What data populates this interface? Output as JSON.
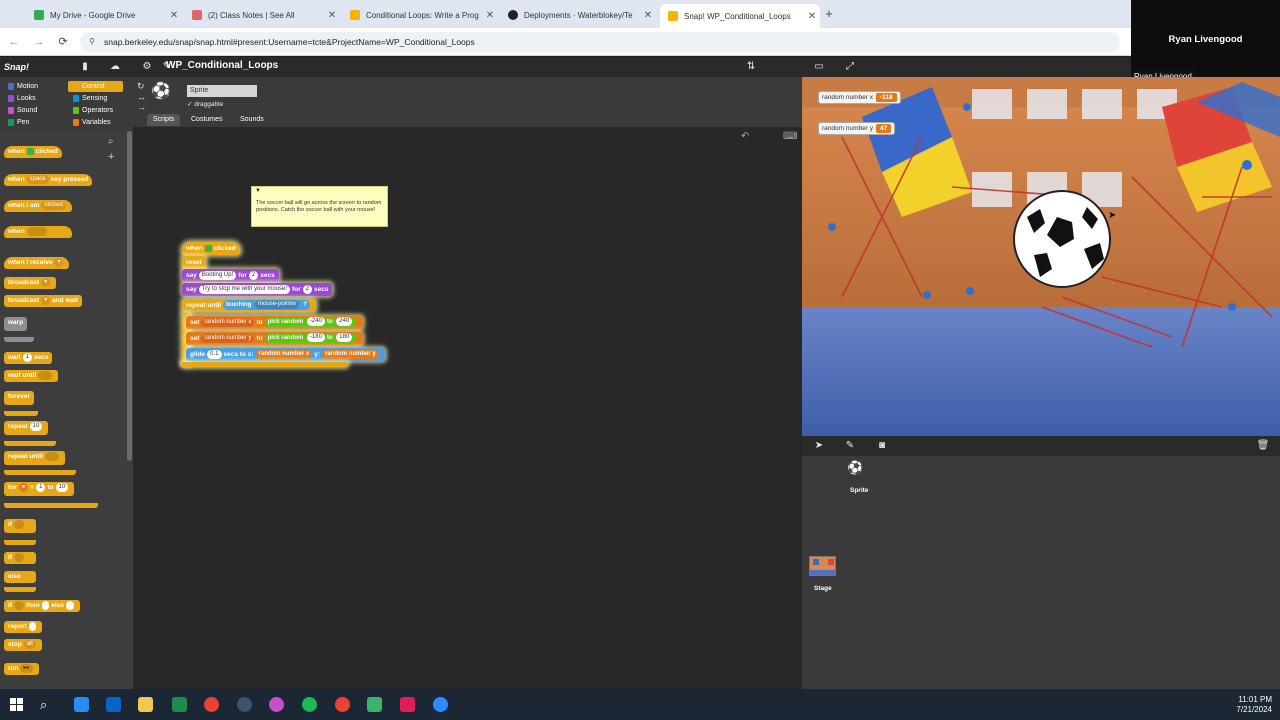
{
  "browser": {
    "tabs": [
      {
        "label": "My Drive - Google Drive",
        "color": "#34a853"
      },
      {
        "label": "(2) Class Notes | See All",
        "color": "#e06666"
      },
      {
        "label": "Conditional Loops: Write a Prog",
        "color": "#f4b400"
      },
      {
        "label": "Deployments · Waterblokey/Te",
        "color": "#222222"
      },
      {
        "label": "Snap! WP_Conditional_Loops",
        "color": "#f4b400"
      }
    ],
    "url": "snap.berkeley.edu/snap/snap.html#present:Username=tcte&ProjectName=WP_Conditional_Loops"
  },
  "zoom": {
    "participant_name": "Ryan Livengood",
    "name_tag": "Ryan Livengood"
  },
  "snap": {
    "project_title": "WP_Conditional_Loops",
    "categories": [
      "Motion",
      "Looks",
      "Sound",
      "Pen",
      "Control",
      "Sensing",
      "Operators",
      "Variables"
    ],
    "sprite_name": "Sprite",
    "draggable_label": "draggable",
    "tabs": [
      "Scripts",
      "Costumes",
      "Sounds"
    ],
    "palette": {
      "when_flag": {
        "a": "when",
        "b": "clicked"
      },
      "when_key": {
        "a": "when",
        "slot": "space",
        "b": "key pressed"
      },
      "when_i_am": {
        "a": "when I am",
        "slot": "clicked"
      },
      "when_cond": "when",
      "when_receive": {
        "a": "when I receive"
      },
      "broadcast": "broadcast",
      "broadcast_wait": {
        "a": "broadcast",
        "b": "and wait"
      },
      "warp": "warp",
      "wait": {
        "a": "wait",
        "slot": "1",
        "b": "secs"
      },
      "wait_until": "wait until",
      "forever": "forever",
      "repeat": {
        "a": "repeat",
        "slot": "10"
      },
      "repeat_until": "repeat until",
      "for": {
        "a": "for",
        "b": "=",
        "slot1": "1",
        "c": "to",
        "slot2": "10"
      },
      "if": "if",
      "if_else_a": "if",
      "if_else_b": "else",
      "if_then_else": {
        "a": "if",
        "b": "then",
        "c": "else"
      },
      "report": "report",
      "stop": {
        "a": "stop",
        "slot": "all"
      },
      "run": "run"
    },
    "comment": "The soccer ball will go across the screen to random positions. Catch the soccer ball with your mouse!",
    "script": {
      "hat": {
        "a": "when",
        "b": "clicked"
      },
      "reset": "reset",
      "say1": {
        "a": "say",
        "slot": "Booting Up!",
        "b": "for",
        "secs": "2",
        "c": "secs"
      },
      "say2": {
        "a": "say",
        "slot": "Try to stop me with your mouse!",
        "b": "for",
        "secs": "2",
        "c": "secs"
      },
      "repeat_until": {
        "a": "repeat until",
        "touching": "touching",
        "target": "mouse-pointer",
        "q": "?"
      },
      "set_x": {
        "a": "set",
        "var": "random number x",
        "b": "to",
        "c": "pick random",
        "min": "-240",
        "d": "to",
        "max": "240"
      },
      "set_y": {
        "a": "set",
        "var": "random number y",
        "b": "to",
        "c": "pick random",
        "min": "-180",
        "d": "to",
        "max": "180"
      },
      "glide": {
        "a": "glide",
        "secs": "0.1",
        "b": "secs to x:",
        "x": "random number x",
        "c": "y:",
        "y": "random number y"
      }
    },
    "watchers": [
      {
        "label": "random number x",
        "value": "-118"
      },
      {
        "label": "random number y",
        "value": "47"
      }
    ],
    "corral": {
      "sprite_label": "Sprite",
      "stage_label": "Stage"
    }
  },
  "taskbar": {
    "time": "11:01 PM",
    "date": "7/21/2024",
    "icons": [
      {
        "name": "windows-start-icon",
        "color": "#ffffff"
      },
      {
        "name": "search-icon",
        "color": "#ffffff"
      },
      {
        "name": "app-icon-1",
        "color": "#2d8cf0"
      },
      {
        "name": "app-icon-2",
        "color": "#0a64c8"
      },
      {
        "name": "file-explorer-icon",
        "color": "#f2c94c"
      },
      {
        "name": "excel-icon",
        "color": "#1f8a4c"
      },
      {
        "name": "chrome-icon",
        "color": "#ea4335"
      },
      {
        "name": "steam-icon",
        "color": "#1b2838"
      },
      {
        "name": "app-icon-3",
        "color": "#c94fc9"
      },
      {
        "name": "spotify-icon",
        "color": "#1db954"
      },
      {
        "name": "chrome-profile-icon",
        "color": "#ea4335"
      },
      {
        "name": "notes-icon",
        "color": "#3db26b"
      },
      {
        "name": "slack-icon",
        "color": "#e01e5a"
      },
      {
        "name": "zoom-icon",
        "color": "#2d8cff"
      }
    ]
  }
}
